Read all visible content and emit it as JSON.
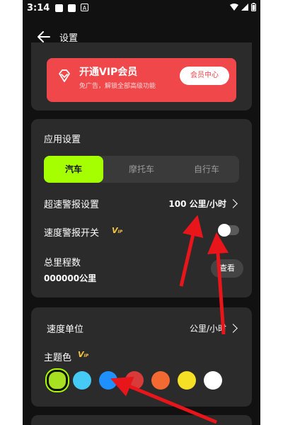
{
  "status_bar": {
    "time": "3:14"
  },
  "header": {
    "title": "设置"
  },
  "vip": {
    "title": "开通VIP会员",
    "subtitle": "免广告，解锁全部高级功能",
    "button": "会员中心"
  },
  "app_settings": {
    "title": "应用设置",
    "vehicle_tabs": [
      {
        "label": "汽车",
        "active": true
      },
      {
        "label": "摩托车",
        "active": false
      },
      {
        "label": "自行车",
        "active": false
      }
    ],
    "overspeed_label": "超速警报设置",
    "overspeed_value": "100 公里/小时",
    "speed_alert_label": "速度警报开关",
    "speed_alert_on": false,
    "odometer_label": "总里程数",
    "odometer_value": "000000公里",
    "view_button": "查看"
  },
  "display": {
    "speed_unit_label": "速度单位",
    "speed_unit_value": "公里/小时",
    "theme_label": "主题色",
    "theme_colors": [
      "#a6e021",
      "#45c9f5",
      "#1e90ff",
      "#d93a3a",
      "#f26a32",
      "#f5e025",
      "#ffffff"
    ],
    "selected_theme_index": 0
  },
  "vip_tag": {
    "main": "V",
    "sub": "IP"
  },
  "colors": {
    "accent": "#a6ff00",
    "vip": "#f0474b",
    "card": "#2b2b2b",
    "annotation_arrow": "#e8151b"
  }
}
